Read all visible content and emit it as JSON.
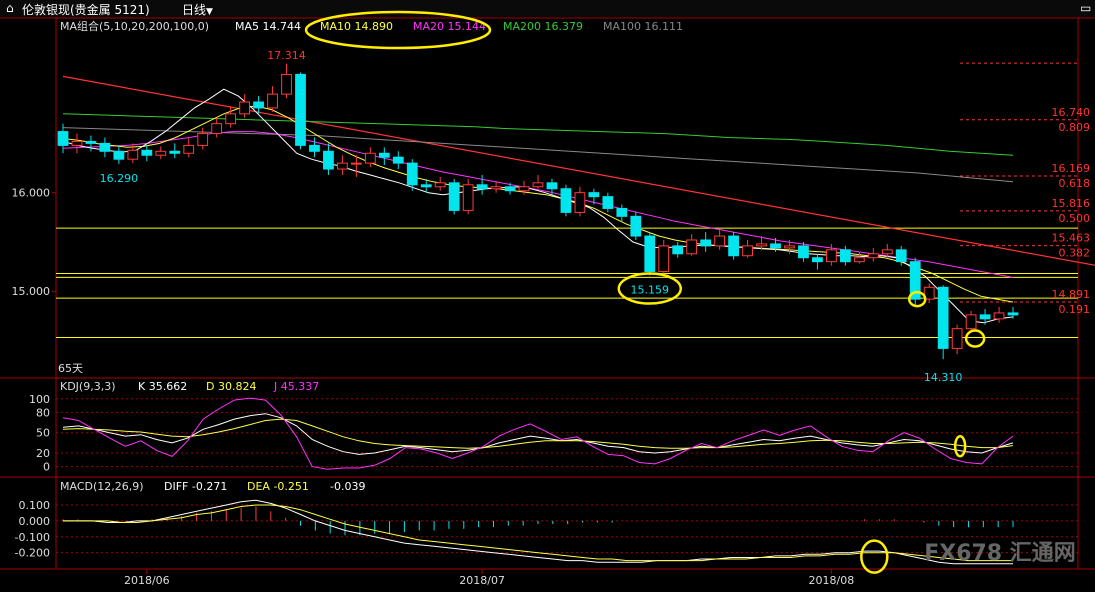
{
  "topbar": {
    "instrument": "伦敦银现(贵金属 5121)",
    "period": "日线",
    "period_arrow": "▼",
    "maximize_icon": "maximize-icon"
  },
  "colors": {
    "up": "#ff3b3b",
    "down": "#00e5ee",
    "ma5": "#ffffff",
    "ma10": "#ffff44",
    "ma20": "#ff33ff",
    "ma200": "#33cc33",
    "ma100": "#888888",
    "trend": "#ff3333",
    "hline": "#ffff00",
    "fib": "#ff3333",
    "grid": "#aa0000",
    "highlight": "#ffee00"
  },
  "chart_data": [
    {
      "type": "candlestick",
      "legend": {
        "name": "MA组合(5,10,20,200,100,0)",
        "items": [
          {
            "label": "MA5 14.744",
            "color": "#ffffff"
          },
          {
            "label": "MA10 14.890",
            "color": "#ffff44"
          },
          {
            "label": "MA20 15.144",
            "color": "#ff33ff"
          },
          {
            "label": "MA200 16.379",
            "color": "#33cc33"
          },
          {
            "label": "MA100 16.111",
            "color": "#888888"
          }
        ]
      },
      "ylim": [
        14.15,
        17.6
      ],
      "y_ticks": [
        "16.000",
        "15.000"
      ],
      "y_tick_values": [
        16.0,
        15.0
      ],
      "x_ticks": [
        "2018/06",
        "2018/07",
        "2018/08"
      ],
      "x_tick_index": [
        6,
        30,
        55
      ],
      "annotations": {
        "high": "17.314",
        "low_left": "16.290",
        "low_mid": "15.159",
        "low_right": "14.310",
        "days": "65天"
      },
      "fib_levels": [
        {
          "price": "16.740",
          "ratio": "0.809"
        },
        {
          "price": "16.169",
          "ratio": "0.618"
        },
        {
          "price": "15.816",
          "ratio": "0.500"
        },
        {
          "price": "15.463",
          "ratio": "0.382"
        },
        {
          "price": "14.891",
          "ratio": "0.191"
        }
      ],
      "fib_values": [
        16.74,
        16.169,
        15.816,
        15.463,
        14.891,
        17.314
      ],
      "horizontal_lines": [
        15.64,
        15.18,
        15.14,
        14.93,
        14.53
      ],
      "trend_line": [
        [
          0,
          17.18
        ],
        [
          79,
          15.13
        ]
      ],
      "candles": [
        [
          16.62,
          16.48,
          16.7,
          16.4
        ],
        [
          16.48,
          16.52,
          16.6,
          16.4
        ],
        [
          16.52,
          16.5,
          16.58,
          16.42
        ],
        [
          16.5,
          16.42,
          16.56,
          16.36
        ],
        [
          16.42,
          16.34,
          16.48,
          16.29
        ],
        [
          16.34,
          16.43,
          16.5,
          16.3
        ],
        [
          16.43,
          16.38,
          16.48,
          16.32
        ],
        [
          16.38,
          16.42,
          16.47,
          16.34
        ],
        [
          16.42,
          16.4,
          16.5,
          16.35
        ],
        [
          16.4,
          16.48,
          16.55,
          16.36
        ],
        [
          16.48,
          16.6,
          16.66,
          16.44
        ],
        [
          16.6,
          16.7,
          16.76,
          16.56
        ],
        [
          16.7,
          16.8,
          16.88,
          16.66
        ],
        [
          16.8,
          16.92,
          17.0,
          16.76
        ],
        [
          16.92,
          16.86,
          16.98,
          16.8
        ],
        [
          16.86,
          17.0,
          17.08,
          16.82
        ],
        [
          17.0,
          17.2,
          17.31,
          16.96
        ],
        [
          17.2,
          16.48,
          17.22,
          16.44
        ],
        [
          16.48,
          16.42,
          16.56,
          16.36
        ],
        [
          16.42,
          16.24,
          16.5,
          16.18
        ],
        [
          16.24,
          16.3,
          16.38,
          16.18
        ],
        [
          16.3,
          16.3,
          16.38,
          16.16
        ],
        [
          16.3,
          16.4,
          16.46,
          16.26
        ],
        [
          16.4,
          16.36,
          16.46,
          16.28
        ],
        [
          16.36,
          16.3,
          16.42,
          16.24
        ],
        [
          16.3,
          16.08,
          16.34,
          16.02
        ],
        [
          16.08,
          16.06,
          16.14,
          16.0
        ],
        [
          16.06,
          16.1,
          16.16,
          16.02
        ],
        [
          16.1,
          15.82,
          16.14,
          15.78
        ],
        [
          15.82,
          16.08,
          16.14,
          15.78
        ],
        [
          16.08,
          16.04,
          16.18,
          15.98
        ],
        [
          16.04,
          16.06,
          16.12,
          16.0
        ],
        [
          16.06,
          16.02,
          16.1,
          15.98
        ],
        [
          16.02,
          16.06,
          16.12,
          15.98
        ],
        [
          16.06,
          16.1,
          16.18,
          16.04
        ],
        [
          16.1,
          16.04,
          16.14,
          15.98
        ],
        [
          16.04,
          15.8,
          16.08,
          15.76
        ],
        [
          15.8,
          16.0,
          16.06,
          15.76
        ],
        [
          16.0,
          15.96,
          16.04,
          15.88
        ],
        [
          15.96,
          15.84,
          16.0,
          15.8
        ],
        [
          15.84,
          15.76,
          15.88,
          15.7
        ],
        [
          15.76,
          15.56,
          15.8,
          15.52
        ],
        [
          15.56,
          15.2,
          15.6,
          15.16
        ],
        [
          15.2,
          15.46,
          15.52,
          15.16
        ],
        [
          15.46,
          15.38,
          15.5,
          15.34
        ],
        [
          15.38,
          15.52,
          15.58,
          15.36
        ],
        [
          15.52,
          15.46,
          15.6,
          15.4
        ],
        [
          15.46,
          15.56,
          15.62,
          15.42
        ],
        [
          15.56,
          15.36,
          15.6,
          15.32
        ],
        [
          15.36,
          15.46,
          15.52,
          15.34
        ],
        [
          15.46,
          15.48,
          15.56,
          15.42
        ],
        [
          15.48,
          15.44,
          15.54,
          15.4
        ],
        [
          15.44,
          15.46,
          15.52,
          15.38
        ],
        [
          15.46,
          15.34,
          15.5,
          15.3
        ],
        [
          15.34,
          15.3,
          15.38,
          15.22
        ],
        [
          15.3,
          15.42,
          15.48,
          15.26
        ],
        [
          15.42,
          15.3,
          15.46,
          15.26
        ],
        [
          15.3,
          15.34,
          15.4,
          15.28
        ],
        [
          15.34,
          15.38,
          15.44,
          15.3
        ],
        [
          15.38,
          15.42,
          15.48,
          15.34
        ],
        [
          15.42,
          15.3,
          15.46,
          15.26
        ],
        [
          15.3,
          14.92,
          15.34,
          14.86
        ],
        [
          14.92,
          15.04,
          15.08,
          14.88
        ],
        [
          15.04,
          14.42,
          15.06,
          14.31
        ],
        [
          14.42,
          14.62,
          14.66,
          14.36
        ],
        [
          14.62,
          14.76,
          14.8,
          14.58
        ],
        [
          14.76,
          14.72,
          14.82,
          14.66
        ],
        [
          14.72,
          14.78,
          14.84,
          14.68
        ],
        [
          14.78,
          14.76,
          14.84,
          14.72
        ]
      ],
      "ma5": [
        16.52,
        16.48,
        16.45,
        16.43,
        16.41,
        16.43,
        16.52,
        16.62,
        16.74,
        16.86,
        16.95,
        17.05,
        16.98,
        16.85,
        16.7,
        16.55,
        16.4,
        16.34,
        16.3,
        16.27,
        16.22,
        16.18,
        16.14,
        16.1,
        16.05,
        16.0,
        15.98,
        16.0,
        16.02,
        16.04,
        16.05,
        16.06,
        16.04,
        16.0,
        15.95,
        15.9,
        15.85,
        15.75,
        15.62,
        15.5,
        15.45,
        15.44,
        15.45,
        15.46,
        15.47,
        15.46,
        15.45,
        15.44,
        15.43,
        15.42,
        15.4,
        15.38,
        15.37,
        15.36,
        15.36,
        15.35,
        15.36,
        15.34,
        15.25,
        15.15,
        15.0,
        14.85,
        14.7,
        14.68,
        14.72,
        14.74
      ],
      "ma10": [
        16.55,
        16.53,
        16.5,
        16.48,
        16.46,
        16.47,
        16.5,
        16.56,
        16.64,
        16.72,
        16.8,
        16.86,
        16.88,
        16.84,
        16.76,
        16.66,
        16.56,
        16.46,
        16.38,
        16.31,
        16.25,
        16.2,
        16.15,
        16.11,
        16.08,
        16.06,
        16.05,
        16.04,
        16.02,
        16.0,
        15.98,
        15.94,
        15.9,
        15.84,
        15.76,
        15.68,
        15.62,
        15.56,
        15.52,
        15.49,
        15.47,
        15.46,
        15.45,
        15.44,
        15.43,
        15.42,
        15.41,
        15.4,
        15.39,
        15.38,
        15.36,
        15.34,
        15.3,
        15.24,
        15.18,
        15.1,
        15.02,
        14.95,
        14.92,
        14.89
      ],
      "ma20": [
        16.45,
        16.46,
        16.47,
        16.48,
        16.5,
        16.53,
        16.56,
        16.6,
        16.62,
        16.62,
        16.6,
        16.56,
        16.51,
        16.46,
        16.41,
        16.36,
        16.31,
        16.26,
        16.21,
        16.17,
        16.13,
        16.09,
        16.05,
        16.01,
        15.96,
        15.91,
        15.86,
        15.81,
        15.76,
        15.71,
        15.67,
        15.63,
        15.59,
        15.55,
        15.51,
        15.48,
        15.45,
        15.42,
        15.39,
        15.36,
        15.33,
        15.3,
        15.26,
        15.22,
        15.18,
        15.14
      ],
      "ma200": [
        16.8,
        16.79,
        16.78,
        16.77,
        16.76,
        16.75,
        16.74,
        16.73,
        16.72,
        16.71,
        16.7,
        16.69,
        16.68,
        16.67,
        16.65,
        16.64,
        16.63,
        16.62,
        16.61,
        16.6,
        16.58,
        16.56,
        16.55,
        16.54,
        16.52,
        16.5,
        16.48,
        16.45,
        16.42,
        16.4,
        16.38
      ],
      "ma100": [
        16.66,
        16.65,
        16.64,
        16.63,
        16.62,
        16.61,
        16.6,
        16.59,
        16.58,
        16.56,
        16.54,
        16.52,
        16.5,
        16.48,
        16.46,
        16.44,
        16.42,
        16.4,
        16.38,
        16.36,
        16.34,
        16.32,
        16.3,
        16.28,
        16.26,
        16.24,
        16.22,
        16.2,
        16.17,
        16.14,
        16.11
      ]
    },
    {
      "type": "line",
      "legend": {
        "name": "KDJ(9,3,3)",
        "items": [
          {
            "label": "K 35.662",
            "color": "#ffffff"
          },
          {
            "label": "D 30.824",
            "color": "#ffff44"
          },
          {
            "label": "J 45.337",
            "color": "#ff33ff"
          }
        ]
      },
      "ylim": [
        -5,
        110
      ],
      "y_ticks": [
        "100",
        "80",
        "50",
        "20",
        "0"
      ],
      "y_tick_values": [
        100,
        80,
        50,
        20,
        0
      ],
      "series": [
        {
          "name": "K",
          "color": "#ffffff",
          "values": [
            58,
            60,
            55,
            50,
            45,
            47,
            40,
            35,
            42,
            55,
            62,
            70,
            75,
            78,
            72,
            60,
            40,
            30,
            22,
            18,
            20,
            25,
            30,
            28,
            25,
            22,
            24,
            28,
            35,
            40,
            45,
            42,
            38,
            40,
            35,
            30,
            28,
            22,
            20,
            22,
            26,
            30,
            28,
            32,
            36,
            40,
            38,
            42,
            45,
            40,
            35,
            32,
            30,
            35,
            40,
            38,
            32,
            26,
            22,
            20,
            28,
            35
          ]
        },
        {
          "name": "D",
          "color": "#ffff44",
          "values": [
            55,
            56,
            55,
            54,
            52,
            51,
            48,
            45,
            44,
            47,
            51,
            56,
            62,
            68,
            70,
            68,
            60,
            52,
            44,
            38,
            34,
            32,
            31,
            30,
            29,
            28,
            27,
            28,
            30,
            33,
            36,
            38,
            38,
            38,
            37,
            35,
            33,
            30,
            28,
            27,
            27,
            28,
            28,
            29,
            31,
            33,
            34,
            36,
            38,
            39,
            38,
            36,
            34,
            34,
            35,
            36,
            35,
            33,
            30,
            28,
            28,
            31
          ]
        },
        {
          "name": "J",
          "color": "#ff33ff",
          "values": [
            72,
            68,
            55,
            42,
            30,
            38,
            24,
            15,
            38,
            70,
            85,
            98,
            101,
            98,
            76,
            44,
            0,
            -4,
            -2,
            -2,
            2,
            12,
            28,
            26,
            20,
            12,
            20,
            30,
            45,
            55,
            63,
            52,
            40,
            44,
            30,
            18,
            16,
            6,
            4,
            12,
            24,
            34,
            28,
            38,
            46,
            54,
            46,
            54,
            60,
            44,
            30,
            24,
            22,
            38,
            50,
            42,
            26,
            12,
            6,
            4,
            28,
            45
          ]
        }
      ]
    },
    {
      "type": "bar",
      "legend": {
        "name": "MACD(12,26,9)",
        "items": [
          {
            "label": "DIFF -0.271",
            "color": "#ffffff"
          },
          {
            "label": "DEA -0.251",
            "color": "#ffff44"
          },
          {
            "label": "-0.039",
            "color": "#ffffff"
          }
        ]
      },
      "ylim": [
        -0.29,
        0.15
      ],
      "y_ticks": [
        "0.100",
        "0.000",
        "-0.100",
        "-0.200"
      ],
      "y_tick_values": [
        0.1,
        0.0,
        -0.1,
        -0.2
      ],
      "macd_hist": [
        0.01,
        0.01,
        0.0,
        0.0,
        0.0,
        0.0,
        0.01,
        0.02,
        0.03,
        0.05,
        0.06,
        0.07,
        0.08,
        0.09,
        0.06,
        0.02,
        -0.03,
        -0.06,
        -0.08,
        -0.09,
        -0.09,
        -0.08,
        -0.08,
        -0.07,
        -0.06,
        -0.06,
        -0.05,
        -0.05,
        -0.04,
        -0.04,
        -0.03,
        -0.03,
        -0.02,
        -0.02,
        -0.02,
        -0.01,
        -0.01,
        -0.01,
        0.0,
        0.0,
        0.0,
        0.0,
        0.0,
        0.0,
        0.0,
        0.0,
        0.0,
        0.0,
        0.0,
        0.0,
        0.0,
        0.0,
        0.0,
        0.0,
        0.01,
        0.01,
        0.01,
        0.0,
        -0.01,
        -0.03,
        -0.04,
        -0.04,
        -0.04,
        -0.04,
        -0.04
      ],
      "diff": [
        0.0,
        0.0,
        0.0,
        -0.01,
        -0.01,
        0.0,
        0.0,
        0.02,
        0.04,
        0.06,
        0.08,
        0.1,
        0.12,
        0.13,
        0.11,
        0.08,
        0.04,
        0.0,
        -0.03,
        -0.06,
        -0.08,
        -0.1,
        -0.12,
        -0.14,
        -0.15,
        -0.16,
        -0.17,
        -0.18,
        -0.19,
        -0.2,
        -0.21,
        -0.22,
        -0.23,
        -0.24,
        -0.25,
        -0.25,
        -0.26,
        -0.26,
        -0.26,
        -0.26,
        -0.25,
        -0.25,
        -0.25,
        -0.24,
        -0.24,
        -0.23,
        -0.23,
        -0.23,
        -0.22,
        -0.22,
        -0.21,
        -0.21,
        -0.2,
        -0.2,
        -0.19,
        -0.19,
        -0.2,
        -0.22,
        -0.24,
        -0.26,
        -0.27,
        -0.27,
        -0.27,
        -0.27,
        -0.27
      ],
      "dea": [
        0.0,
        0.0,
        0.0,
        0.0,
        -0.01,
        -0.01,
        0.0,
        0.01,
        0.02,
        0.04,
        0.05,
        0.07,
        0.09,
        0.1,
        0.1,
        0.09,
        0.07,
        0.04,
        0.01,
        -0.02,
        -0.04,
        -0.06,
        -0.08,
        -0.1,
        -0.12,
        -0.13,
        -0.14,
        -0.15,
        -0.16,
        -0.17,
        -0.18,
        -0.19,
        -0.2,
        -0.21,
        -0.22,
        -0.23,
        -0.24,
        -0.24,
        -0.25,
        -0.25,
        -0.25,
        -0.25,
        -0.25,
        -0.25,
        -0.24,
        -0.24,
        -0.24,
        -0.23,
        -0.23,
        -0.23,
        -0.22,
        -0.22,
        -0.21,
        -0.21,
        -0.2,
        -0.2,
        -0.2,
        -0.21,
        -0.22,
        -0.23,
        -0.24,
        -0.25,
        -0.25,
        -0.25,
        -0.25
      ]
    }
  ],
  "watermark": {
    "text": "FX678 汇通网"
  }
}
